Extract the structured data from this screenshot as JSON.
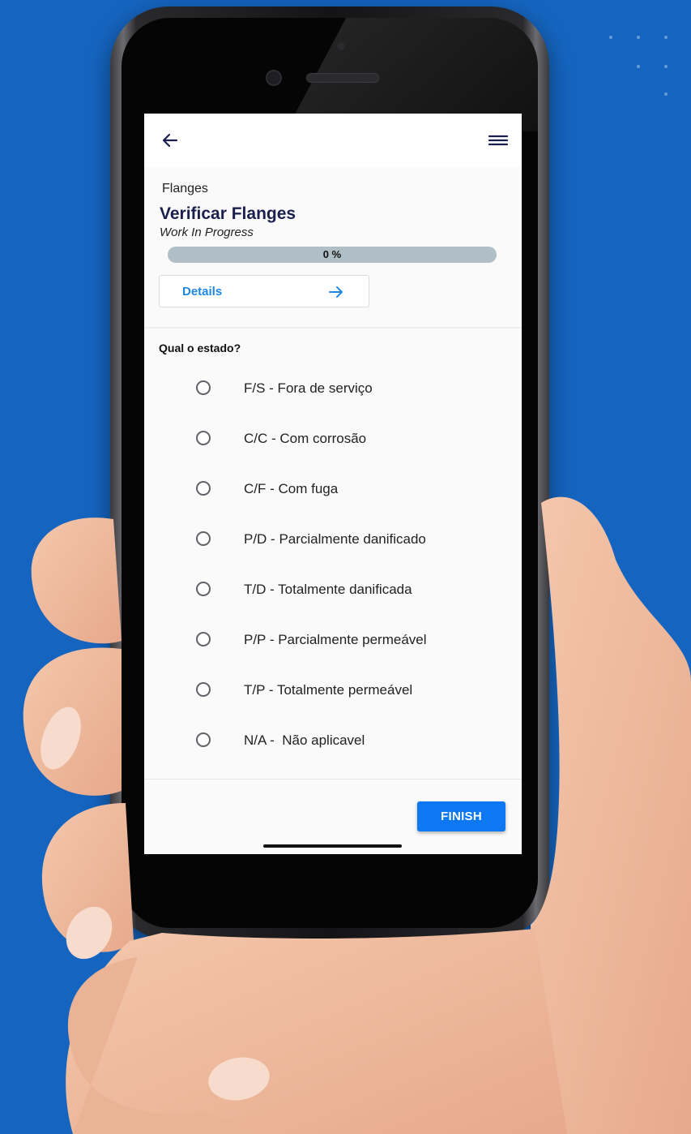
{
  "app": {
    "breadcrumb": "Flanges",
    "task_title": "Verificar Flanges",
    "task_status": "Work In Progress",
    "progress": {
      "percent": 0,
      "label": "0 %"
    },
    "details_label": "Details",
    "question": "Qual o estado?",
    "options": [
      {
        "label": "F/S - Fora de serviço",
        "selected": false
      },
      {
        "label": "C/C - Com corrosão",
        "selected": false
      },
      {
        "label": "C/F - Com fuga",
        "selected": false
      },
      {
        "label": "P/D - Parcialmente danificado",
        "selected": false
      },
      {
        "label": "T/D - Totalmente danificada",
        "selected": false
      },
      {
        "label": "P/P - Parcialmente permeável",
        "selected": false
      },
      {
        "label": "T/P - Totalmente permeável",
        "selected": false
      },
      {
        "label": "N/A -  Não aplicavel",
        "selected": false
      }
    ],
    "finish_label": "FINISH"
  },
  "icons": {
    "back": "arrow-left-icon",
    "menu": "hamburger-menu-icon",
    "details": "arrow-right-icon"
  },
  "colors": {
    "background": "#1565c0",
    "accent": "#1e88e5",
    "finish_button": "#0d78f2",
    "title": "#1a1f4d",
    "progress_track": "#b0bec5"
  }
}
